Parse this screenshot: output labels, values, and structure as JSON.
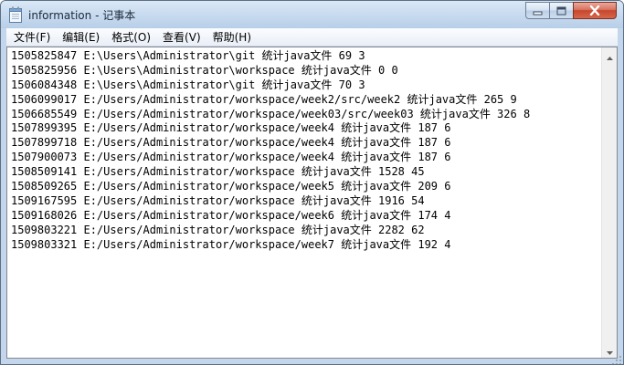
{
  "window": {
    "title": "information - 记事本"
  },
  "menu": {
    "items": [
      {
        "label": "文件(F)"
      },
      {
        "label": "编辑(E)"
      },
      {
        "label": "格式(O)"
      },
      {
        "label": "查看(V)"
      },
      {
        "label": "帮助(H)"
      }
    ]
  },
  "editor": {
    "lines": [
      "1505825847 E:\\Users\\Administrator\\git 统计java文件 69 3",
      "1505825956 E:\\Users\\Administrator\\workspace 统计java文件 0 0",
      "1506084348 E:\\Users\\Administrator\\git 统计java文件 70 3",
      "1506099017 E:/Users/Administrator/workspace/week2/src/week2 统计java文件 265 9",
      "1506685549 E:/Users/Administrator/workspace/week03/src/week03 统计java文件 326 8",
      "1507899395 E:/Users/Administrator/workspace/week4 统计java文件 187 6",
      "1507899718 E:/Users/Administrator/workspace/week4 统计java文件 187 6",
      "1507900073 E:/Users/Administrator/workspace/week4 统计java文件 187 6",
      "1508509141 E:/Users/Administrator/workspace 统计java文件 1528 45",
      "1508509265 E:/Users/Administrator/workspace/week5 统计java文件 209 6",
      "1509167595 E:/Users/Administrator/workspace 统计java文件 1916 54",
      "1509168026 E:/Users/Administrator/workspace/week6 统计java文件 174 4",
      "1509803221 E:/Users/Administrator/workspace 统计java文件 2282 62",
      "1509803321 E:/Users/Administrator/workspace/week7 统计java文件 192 4"
    ]
  },
  "icons": {
    "app": "notepad-icon",
    "minimize": "minimize-icon",
    "maximize": "maximize-icon",
    "close": "close-icon",
    "scroll_up": "arrow-up-icon",
    "scroll_down": "arrow-down-icon",
    "resize": "resize-grip-icon"
  }
}
